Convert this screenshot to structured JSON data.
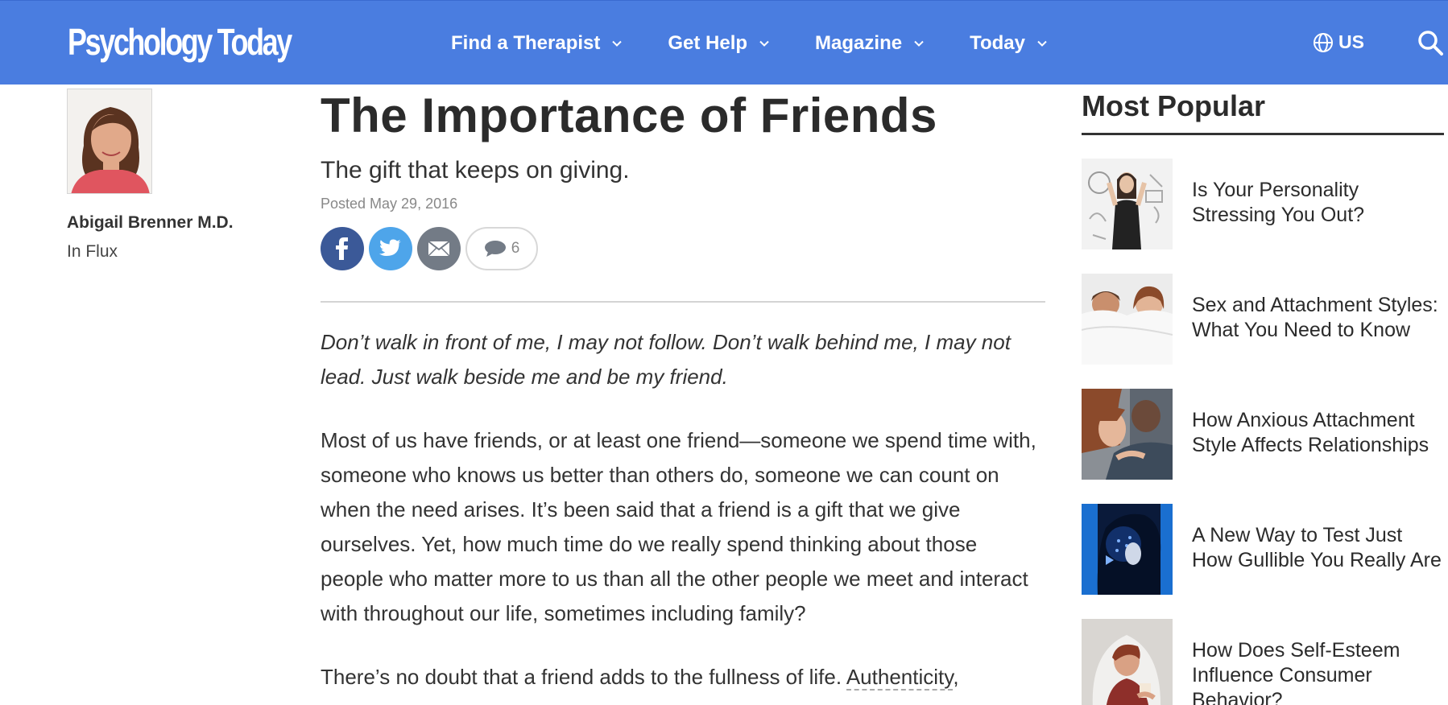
{
  "header": {
    "logo": "Psychology Today",
    "nav": [
      {
        "label": "Find a Therapist"
      },
      {
        "label": "Get Help"
      },
      {
        "label": "Magazine"
      },
      {
        "label": "Today"
      }
    ],
    "region": "US",
    "brand_color": "#4a7de0"
  },
  "author": {
    "name": "Abigail Brenner M.D.",
    "blog": "In Flux"
  },
  "article": {
    "title": "The Importance of Friends",
    "subtitle": "The gift that keeps on giving.",
    "posted": "Posted May 29, 2016",
    "share": {
      "facebook_icon": "facebook-icon",
      "twitter_icon": "twitter-icon",
      "email_icon": "email-icon",
      "comment_count": "6"
    },
    "quote": "Don’t walk in front of me, I may not follow. Don’t walk behind me, I may not lead. Just walk beside me and be my friend.",
    "paragraph1": "Most of us have friends, or at least one friend—someone we spend time with, someone who knows us better than others do, someone we can count on when the need arises. It’s been said that a friend is a gift that we give ourselves. Yet, how much time do we really spend thinking about those people who matter more to us than all the other people we meet and interact with throughout our life, sometimes including family?",
    "paragraph2_start": "There’s no doubt that a friend adds to the fullness of life. ",
    "paragraph2_link": "Authenticity",
    "paragraph2_end": ","
  },
  "sidebar": {
    "heading": "Most Popular",
    "items": [
      {
        "title": "Is Your Personality Stressing You Out?"
      },
      {
        "title": "Sex and Attachment Styles: What You Need to Know"
      },
      {
        "title": "How Anxious Attachment Style Affects Relationships"
      },
      {
        "title": "A New Way to Test Just How Gullible You Really Are"
      },
      {
        "title": "How Does Self-Esteem Influence Consumer Behavior?"
      }
    ]
  }
}
